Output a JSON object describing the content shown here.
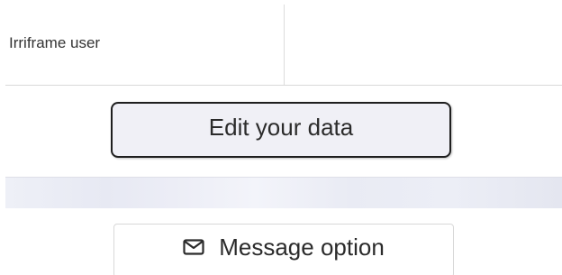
{
  "profile_table": {
    "label": "Irriframe user",
    "value": ""
  },
  "actions": {
    "edit_label": "Edit your data",
    "message_label": "Message option",
    "message_icon": "envelope-icon"
  },
  "colors": {
    "edit_button_bg": "#f0f0f6",
    "edit_button_border": "#1f1f1f",
    "banner_tint": "#eceef6"
  }
}
